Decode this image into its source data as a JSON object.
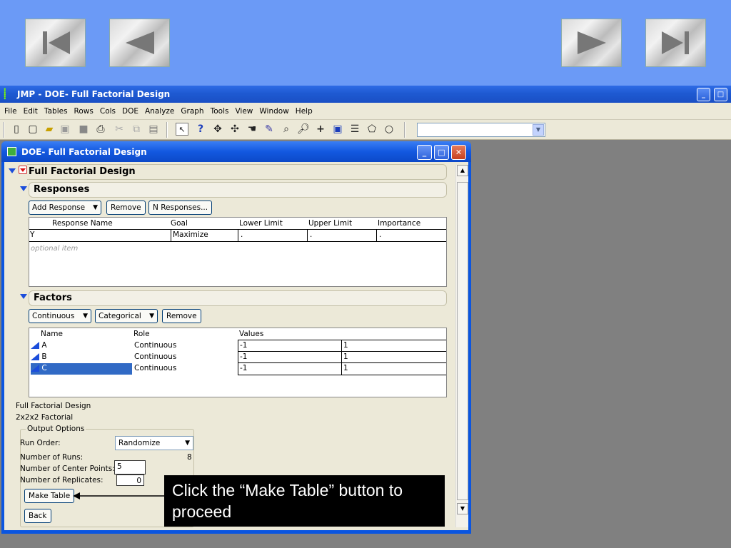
{
  "slide_nav": {
    "first": "first-slide-icon",
    "prev": "previous-slide-icon",
    "next": "next-slide-icon",
    "last": "last-slide-icon"
  },
  "app": {
    "title": "JMP - DOE- Full Factorial Design",
    "menu": [
      "File",
      "Edit",
      "Tables",
      "Rows",
      "Cols",
      "DOE",
      "Analyze",
      "Graph",
      "Tools",
      "View",
      "Window",
      "Help"
    ],
    "toolbar_combo_value": ""
  },
  "doe_window": {
    "title": "DOE- Full Factorial Design",
    "main_outline": "Full Factorial Design",
    "responses": {
      "title": "Responses",
      "add_response": "Add Response",
      "remove": "Remove",
      "n_responses": "N Responses...",
      "columns": [
        "Response Name",
        "Goal",
        "Lower Limit",
        "Upper Limit",
        "Importance"
      ],
      "rows": [
        {
          "name": "Y",
          "goal": "Maximize",
          "lower": ".",
          "upper": ".",
          "importance": "."
        }
      ],
      "optional_hint": "optional item"
    },
    "factors": {
      "title": "Factors",
      "continuous": "Continuous",
      "categorical": "Categorical",
      "remove": "Remove",
      "columns": [
        "Name",
        "Role",
        "Values"
      ],
      "rows": [
        {
          "name": "A",
          "role": "Continuous",
          "low": "-1",
          "high": "1"
        },
        {
          "name": "B",
          "role": "Continuous",
          "low": "-1",
          "high": "1"
        },
        {
          "name": "C",
          "role": "Continuous",
          "low": "-1",
          "high": "1"
        }
      ]
    },
    "design_name": "Full Factorial Design",
    "design_type": "2x2x2 Factorial",
    "output_options": {
      "legend": "Output Options",
      "run_order_label": "Run Order:",
      "run_order_value": "Randomize",
      "runs_label": "Number of Runs:",
      "runs_value": "8",
      "center_label": "Number of Center Points:",
      "center_value": "5",
      "replicates_label": "Number of Replicates:",
      "replicates_value": "0",
      "make_table": "Make Table",
      "back": "Back"
    }
  },
  "callout": {
    "text": "Click the “Make Table” button to proceed"
  },
  "colors": {
    "slide_bg": "#6B9AF6",
    "xp_title": "#1E5AD2",
    "window_face": "#ECE9D8",
    "selection": "#316AC5"
  }
}
